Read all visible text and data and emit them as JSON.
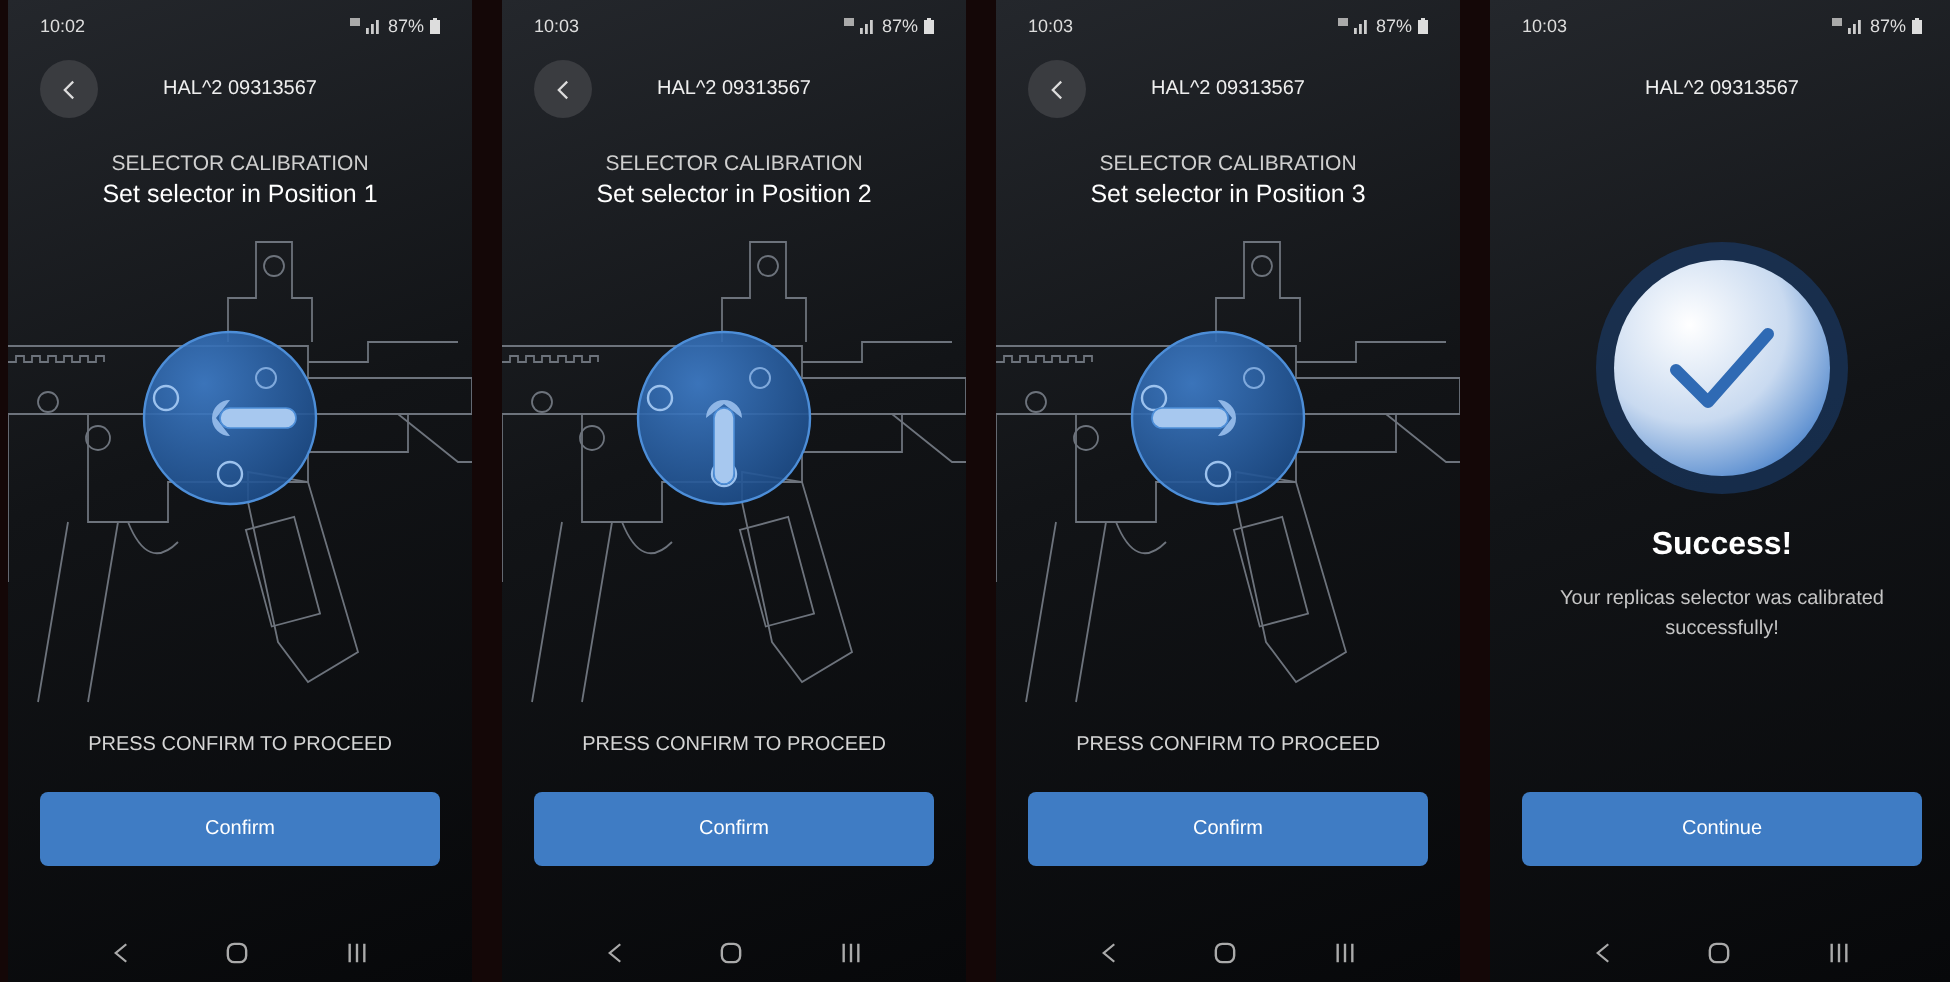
{
  "screens": [
    {
      "kind": "calibration",
      "status": {
        "time": "10:02",
        "battery": "87%"
      },
      "header": {
        "title": "HAL^2 09313567",
        "back": true
      },
      "subtitle": "SELECTOR CALIBRATION",
      "title": "Set selector in Position 1",
      "dial": {
        "kind": "right"
      },
      "prompt": "PRESS CONFIRM TO PROCEED",
      "button": "Confirm"
    },
    {
      "kind": "calibration",
      "status": {
        "time": "10:03",
        "battery": "87%"
      },
      "header": {
        "title": "HAL^2 09313567",
        "back": true
      },
      "subtitle": "SELECTOR CALIBRATION",
      "title": "Set selector in Position 2",
      "dial": {
        "kind": "down"
      },
      "prompt": "PRESS CONFIRM TO PROCEED",
      "button": "Confirm"
    },
    {
      "kind": "calibration",
      "status": {
        "time": "10:03",
        "battery": "87%"
      },
      "header": {
        "title": "HAL^2 09313567",
        "back": true
      },
      "subtitle": "SELECTOR CALIBRATION",
      "title": "Set selector in Position 3",
      "dial": {
        "kind": "left"
      },
      "prompt": "PRESS CONFIRM TO PROCEED",
      "button": "Confirm"
    },
    {
      "kind": "success",
      "status": {
        "time": "10:03",
        "battery": "87%"
      },
      "header": {
        "title": "HAL^2 09313567",
        "back": false
      },
      "heading": "Success!",
      "message": "Your replicas selector was calibrated successfully!",
      "button": "Continue"
    }
  ]
}
